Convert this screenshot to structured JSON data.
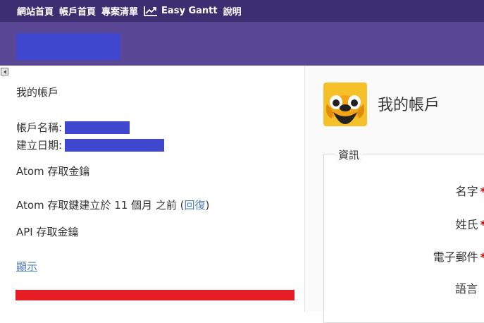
{
  "topmenu": {
    "home": "網站首頁",
    "my_page": "帳戶首頁",
    "projects": "專案清單",
    "easy_gantt": "Easy Gantt",
    "help": "說明"
  },
  "sidebar": {
    "title": "我的帳戶",
    "login_label": "帳戶名稱:",
    "created_label": "建立日期:",
    "atom_key": "Atom 存取金鑰",
    "atom_created_prefix": "Atom 存取鍵建立於 11 個月 之前 (",
    "reset_link": "回復",
    "atom_created_suffix": ")",
    "api_key": "API 存取金鑰",
    "show_link": "顯示"
  },
  "content": {
    "page_title": "我的帳戶",
    "legend": "資訊",
    "fields": [
      "名字",
      "姓氏",
      "電子郵件",
      "語言"
    ],
    "required_mark": "*"
  },
  "colors": {
    "top_menu_bg": "#3d2e72",
    "header_bg": "#5a4897",
    "redaction": "#3f47cf",
    "red_bar": "#e81c24",
    "link": "#4e7fb8",
    "required": "#cc0000"
  }
}
